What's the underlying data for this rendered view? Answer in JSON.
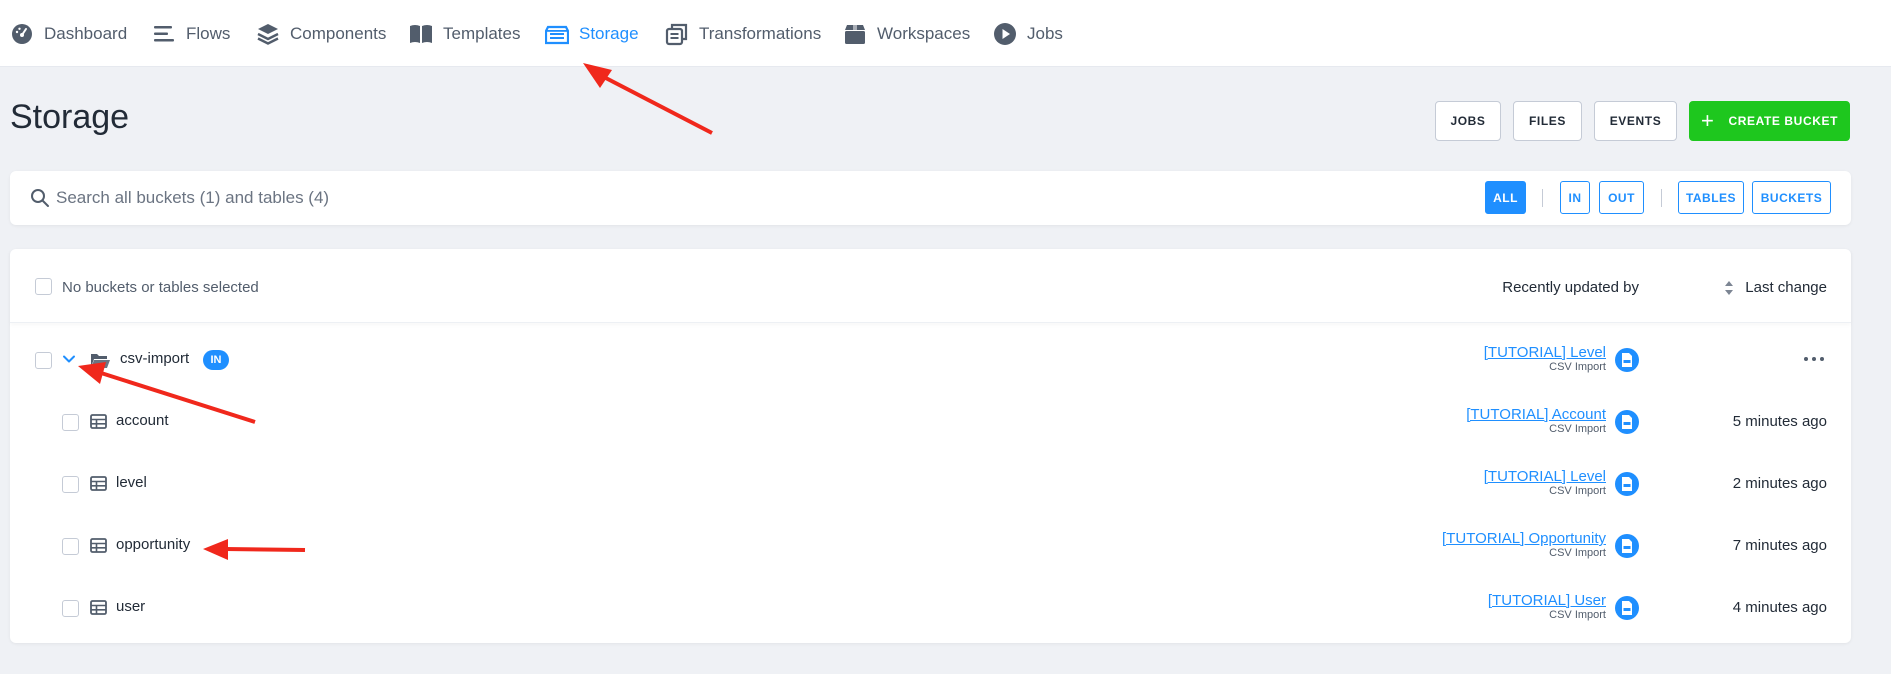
{
  "nav": {
    "items": [
      {
        "label": "Dashboard",
        "icon": "gauge-icon"
      },
      {
        "label": "Flows",
        "icon": "flows-icon"
      },
      {
        "label": "Components",
        "icon": "layers-icon"
      },
      {
        "label": "Templates",
        "icon": "book-icon"
      },
      {
        "label": "Storage",
        "icon": "storage-icon",
        "active": true
      },
      {
        "label": "Transformations",
        "icon": "transform-icon"
      },
      {
        "label": "Workspaces",
        "icon": "box-icon"
      },
      {
        "label": "Jobs",
        "icon": "play-icon"
      }
    ]
  },
  "page": {
    "title": "Storage",
    "buttons": {
      "jobs": "JOBS",
      "files": "FILES",
      "events": "EVENTS",
      "create_bucket": "CREATE BUCKET"
    }
  },
  "search": {
    "placeholder": "Search all buckets (1) and tables (4)",
    "filters": {
      "all": "ALL",
      "in": "IN",
      "out": "OUT",
      "tables": "TABLES",
      "buckets": "BUCKETS"
    }
  },
  "table": {
    "selection_text": "No buckets or tables selected",
    "col_updated_by": "Recently updated by",
    "col_last_change": "Last change",
    "bucket": {
      "name": "csv-import",
      "stage": "IN",
      "updated_by": "[TUTORIAL] Level",
      "updated_by_component": "CSV Import"
    },
    "rows": [
      {
        "name": "account",
        "updated_by": "[TUTORIAL] Account",
        "updated_by_component": "CSV Import",
        "last_change": "5 minutes ago"
      },
      {
        "name": "level",
        "updated_by": "[TUTORIAL] Level",
        "updated_by_component": "CSV Import",
        "last_change": "2 minutes ago"
      },
      {
        "name": "opportunity",
        "updated_by": "[TUTORIAL] Opportunity",
        "updated_by_component": "CSV Import",
        "last_change": "7 minutes ago"
      },
      {
        "name": "user",
        "updated_by": "[TUTORIAL] User",
        "updated_by_component": "CSV Import",
        "last_change": "4 minutes ago"
      }
    ]
  },
  "colors": {
    "accent": "#1f8fff",
    "create": "#1ec71e",
    "annotation_arrow": "#f0281c",
    "background": "#eff1f5"
  }
}
